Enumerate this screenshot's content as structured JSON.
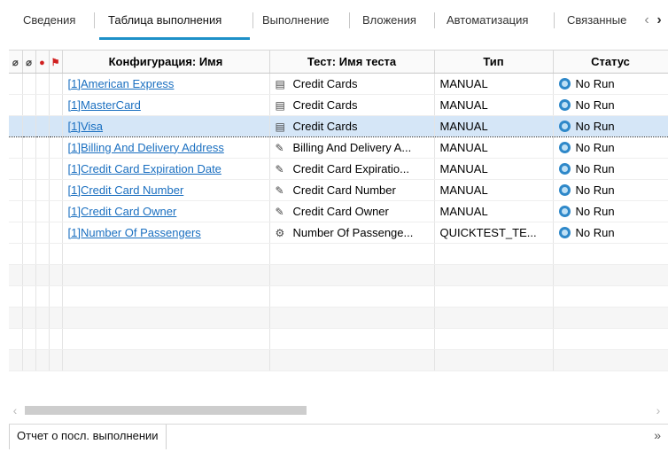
{
  "tabs": [
    {
      "label": "Сведения"
    },
    {
      "label": "Таблица выполнения"
    },
    {
      "label": "Выполнение"
    },
    {
      "label": "Вложения"
    },
    {
      "label": "Автоматизация"
    },
    {
      "label": "Связанные"
    }
  ],
  "grid": {
    "columns": {
      "config_name": "Конфигурация: Имя",
      "test_name": "Тест: Имя теста",
      "type": "Тип",
      "status": "Статус"
    },
    "rows": [
      {
        "config": "[1]American Express",
        "test": "Credit Cards",
        "type": "MANUAL",
        "status": "No Run"
      },
      {
        "config": "[1]MasterCard",
        "test": "Credit Cards",
        "type": "MANUAL",
        "status": "No Run"
      },
      {
        "config": "[1]Visa",
        "test": "Credit Cards",
        "type": "MANUAL",
        "status": "No Run"
      },
      {
        "config": "[1]Billing And Delivery Address",
        "test": "Billing And Delivery A...",
        "type": "MANUAL",
        "status": "No Run"
      },
      {
        "config": "[1]Credit Card Expiration Date",
        "test": "Credit Card Expiratio...",
        "type": "MANUAL",
        "status": "No Run"
      },
      {
        "config": "[1]Credit Card Number",
        "test": "Credit Card Number",
        "type": "MANUAL",
        "status": "No Run"
      },
      {
        "config": "[1]Credit Card Owner",
        "test": "Credit Card Owner",
        "type": "MANUAL",
        "status": "No Run"
      },
      {
        "config": "[1]Number Of Passengers",
        "test": "Number Of Passenge...",
        "type": "QUICKTEST_TE...",
        "status": "No Run"
      }
    ]
  },
  "bottom_panel": {
    "tab_label": "Отчет о посл. выполнении"
  },
  "colors": {
    "accent": "#1e90c8",
    "link": "#1a6fc0",
    "status": "#2e88c9",
    "selected_row": "#d5e6f7"
  }
}
